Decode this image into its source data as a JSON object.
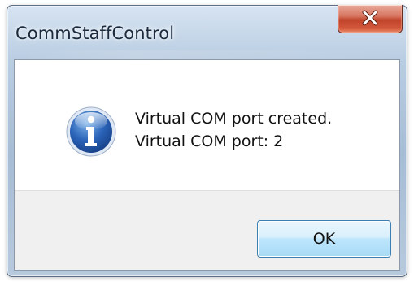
{
  "window": {
    "title": "CommStaffControl",
    "close_glyph": "✕",
    "close_icon": "close-icon"
  },
  "dialog": {
    "icon": "information-icon",
    "message_line1": "Virtual COM port created.",
    "message_line2": "Virtual COM port: 2"
  },
  "buttons": {
    "ok_label": "OK"
  },
  "colors": {
    "close_button": "#c94a30",
    "ok_button_border": "#3c7fb1",
    "info_icon_blue": "#1f55a6",
    "footer_bg": "#f0f0f0"
  }
}
